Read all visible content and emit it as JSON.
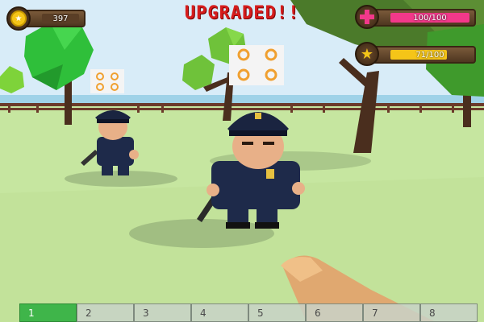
{
  "title": "UPGRADED!!",
  "coins": {
    "value": "397",
    "icon": "coin-icon",
    "color": "#f5c518"
  },
  "health": {
    "text": "100/100",
    "fraction": 1.0,
    "icon": "health-cross-icon",
    "color": "#f2388a"
  },
  "xp": {
    "text": "71/100",
    "fraction": 0.71,
    "icon": "star-icon",
    "color": "#f5c518"
  },
  "hotbar": {
    "selected_index": 0,
    "slots": [
      {
        "label": "1"
      },
      {
        "label": "2"
      },
      {
        "label": "3"
      },
      {
        "label": "4"
      },
      {
        "label": "5"
      },
      {
        "label": "6"
      },
      {
        "label": "7"
      },
      {
        "label": "8"
      }
    ]
  },
  "entities": [
    {
      "type": "police-officer",
      "role": "enemy"
    },
    {
      "type": "police-officer",
      "role": "enemy"
    }
  ],
  "colors": {
    "title": "#d61c1c",
    "hotbar_active": "#3fb54a",
    "sky": "#cfe8f8",
    "grass": "#c6e6a0"
  }
}
